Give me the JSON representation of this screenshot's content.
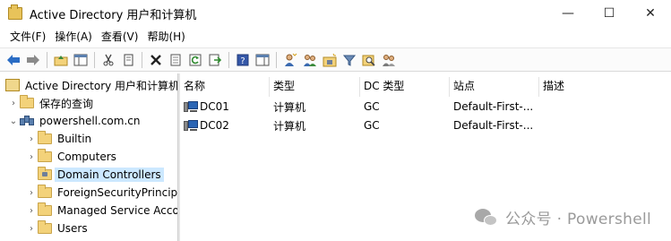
{
  "window": {
    "title": "Active Directory 用户和计算机",
    "controls": {
      "minimize": "—",
      "maximize": "☐",
      "close": "✕"
    }
  },
  "menu": [
    {
      "label": "文件(F)"
    },
    {
      "label": "操作(A)"
    },
    {
      "label": "查看(V)"
    },
    {
      "label": "帮助(H)"
    }
  ],
  "toolbar": {
    "icons": [
      "back-icon",
      "forward-icon",
      "up-folder-icon",
      "show-console-tree-icon",
      "cut-icon",
      "copy-icon",
      "delete-icon",
      "properties-icon",
      "refresh-icon",
      "export-list-icon",
      "help-icon",
      "show-action-pane-icon",
      "new-user-icon",
      "new-group-icon",
      "new-ou-icon",
      "filter-icon",
      "find-icon",
      "add-to-group-icon"
    ]
  },
  "tree": {
    "root": "Active Directory 用户和计算机",
    "items": [
      {
        "label": "保存的查询",
        "expanded": false
      },
      {
        "label": "powershell.com.cn",
        "expanded": true
      },
      {
        "label": "Builtin"
      },
      {
        "label": "Computers"
      },
      {
        "label": "Domain Controllers",
        "selected": true
      },
      {
        "label": "ForeignSecurityPrincipals"
      },
      {
        "label": "Managed Service Accounts"
      },
      {
        "label": "Users"
      }
    ]
  },
  "list": {
    "columns": [
      "名称",
      "类型",
      "DC 类型",
      "站点",
      "描述"
    ],
    "rows": [
      {
        "name": "DC01",
        "type": "计算机",
        "dc_type": "GC",
        "site": "Default-First-...",
        "description": ""
      },
      {
        "name": "DC02",
        "type": "计算机",
        "dc_type": "GC",
        "site": "Default-First-...",
        "description": ""
      }
    ]
  },
  "watermark": {
    "text": "公众号 · Powershell"
  },
  "colors": {
    "selection": "#cce8ff",
    "folder": "#f3d27a",
    "back_arrow": "#2a6cc4"
  }
}
